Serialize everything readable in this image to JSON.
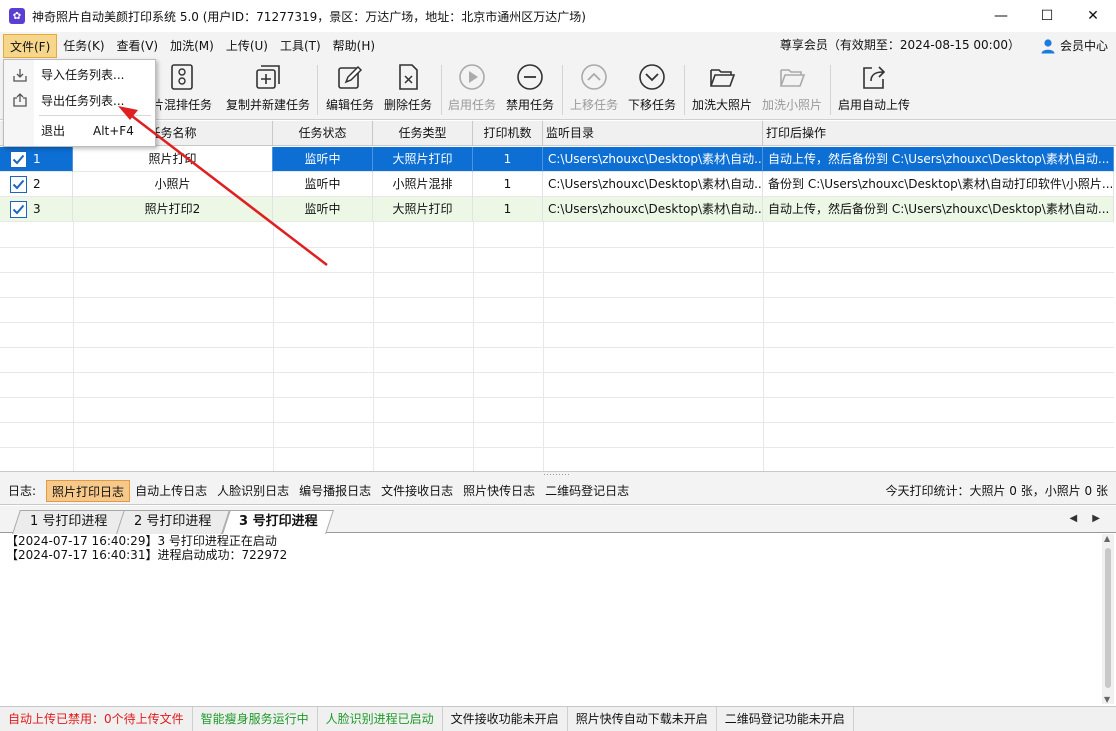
{
  "window": {
    "title": "神奇照片自动美颜打印系统 5.0 (用户ID：71277319，景区：万达广场，地址：北京市通州区万达广场)",
    "minimize": "—",
    "maximize": "☐",
    "close": "✕"
  },
  "menubar": {
    "items": [
      "文件(F)",
      "任务(K)",
      "查看(V)",
      "加洗(M)",
      "上传(U)",
      "工具(T)",
      "帮助(H)"
    ],
    "vip": "尊享会员（有效期至：2024-08-15 00:00）",
    "member_center": "会员中心"
  },
  "file_menu": {
    "import": "导入任务列表...",
    "export": "导出任务列表...",
    "exit": "退出",
    "exit_shortcut": "Alt+F4"
  },
  "toolbar": {
    "mixed": "片混排任务",
    "copy_new": "复制并新建任务",
    "edit": "编辑任务",
    "delete": "删除任务",
    "enable": "启用任务",
    "disable": "禁用任务",
    "move_up": "上移任务",
    "move_down": "下移任务",
    "add_large": "加洗大照片",
    "add_small": "加洗小照片",
    "auto_upload": "启用自动上传"
  },
  "table": {
    "headers": {
      "name": "任务名称",
      "status": "任务状态",
      "type": "任务类型",
      "printers": "打印机数",
      "watch_dir": "监听目录",
      "after_print": "打印后操作"
    },
    "rows": [
      {
        "id": "1",
        "name": "照片打印",
        "status": "监听中",
        "type": "大照片打印",
        "printers": "1",
        "watch_dir": "C:\\Users\\zhouxc\\Desktop\\素材\\自动...",
        "after_print": "自动上传，然后备份到 C:\\Users\\zhouxc\\Desktop\\素材\\自动..."
      },
      {
        "id": "2",
        "name": "小照片",
        "status": "监听中",
        "type": "小照片混排",
        "printers": "1",
        "watch_dir": "C:\\Users\\zhouxc\\Desktop\\素材\\自动...",
        "after_print": "备份到 C:\\Users\\zhouxc\\Desktop\\素材\\自动打印软件\\小照片..."
      },
      {
        "id": "3",
        "name": "照片打印2",
        "status": "监听中",
        "type": "大照片打印",
        "printers": "1",
        "watch_dir": "C:\\Users\\zhouxc\\Desktop\\素材\\自动...",
        "after_print": "自动上传，然后备份到 C:\\Users\\zhouxc\\Desktop\\素材\\自动..."
      }
    ]
  },
  "logbar": {
    "label": "日志:",
    "tabs": [
      "照片打印日志",
      "自动上传日志",
      "人脸识别日志",
      "编号播报日志",
      "文件接收日志",
      "照片快传日志",
      "二维码登记日志"
    ],
    "stats": "今天打印统计：大照片 0 张，小照片 0 张"
  },
  "process_tabs": [
    "1 号打印进程",
    "2 号打印进程",
    "3 号打印进程"
  ],
  "process_nav": "◀ ▶",
  "logs": [
    "【2024-07-17 16:40:29】3 号打印进程正在启动",
    "【2024-07-17 16:40:31】进程启动成功：722972"
  ],
  "statusbar": {
    "upload": "自动上传已禁用：0个待上传文件",
    "slim": "智能瘦身服务运行中",
    "face": "人脸识别进程已启动",
    "receive": "文件接收功能未开启",
    "quick": "照片快传自动下载未开启",
    "qrcode": "二维码登记功能未开启"
  },
  "colors": {
    "selection": "#0d6fd4",
    "alt_row": "#ecf7e6",
    "annotation_arrow": "#e02020",
    "status_red": "#e01b1b",
    "status_green": "#1f9a2a"
  }
}
